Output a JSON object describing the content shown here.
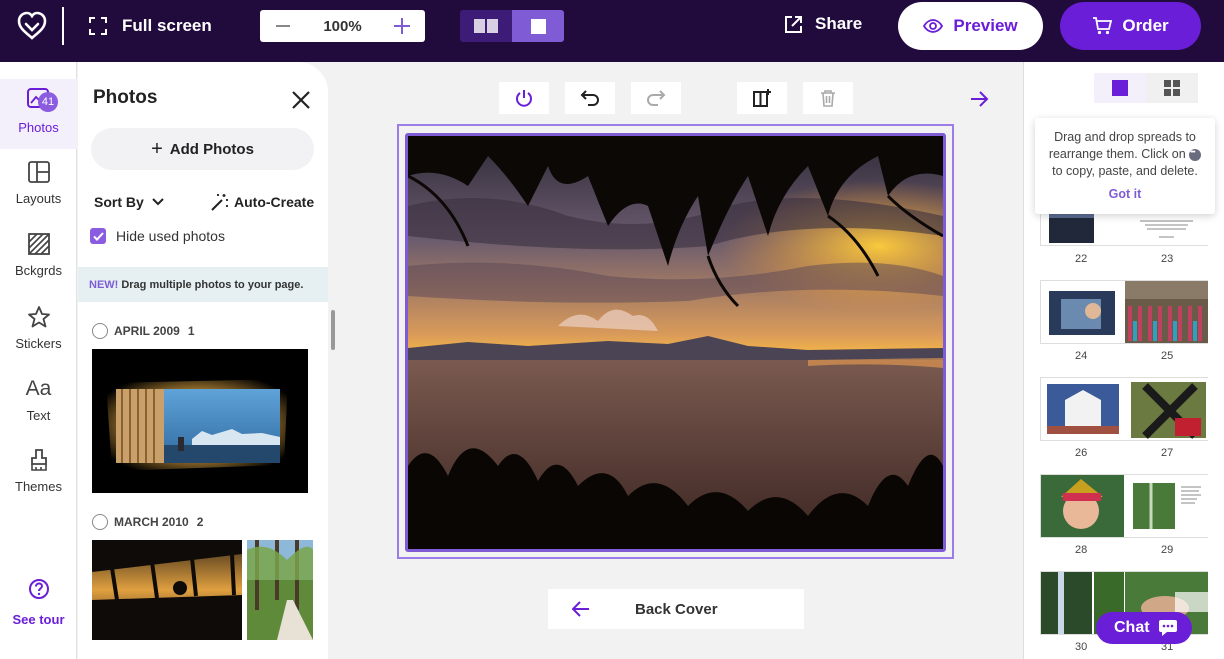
{
  "topbar": {
    "fullscreen_label": "Full screen",
    "zoom_value": "100%",
    "share_label": "Share",
    "preview_label": "Preview",
    "order_label": "Order"
  },
  "rail": {
    "photos_label": "Photos",
    "photos_badge": "41",
    "layouts_label": "Layouts",
    "backgrounds_label": "Bckgrds",
    "stickers_label": "Stickers",
    "text_label": "Text",
    "themes_label": "Themes",
    "seetour_label": "See tour"
  },
  "photos_panel": {
    "title": "Photos",
    "add_label": "Add Photos",
    "sort_label": "Sort By",
    "autocreate_label": "Auto-Create",
    "hide_used_label": "Hide used photos",
    "hide_used_checked": true,
    "notice_new": "NEW!",
    "notice_text": "Drag multiple photos to your page.",
    "groups": [
      {
        "label": "APRIL 2009",
        "count": "1"
      },
      {
        "label": "MARCH 2010",
        "count": "2"
      }
    ]
  },
  "canvas": {
    "back_cover_label": "Back Cover"
  },
  "spreads_panel": {
    "tip_line1": "Drag and drop spreads to",
    "tip_line2": "rearrange them. Click on",
    "tip_line3": "to copy, paste, and delete.",
    "got_it_label": "Got it",
    "page_numbers": [
      "22",
      "23",
      "24",
      "25",
      "26",
      "27",
      "28",
      "29",
      "30",
      "31"
    ]
  },
  "chat_label": "Chat",
  "colors": {
    "topbar_bg": "#210a3c",
    "accent": "#6a1ed8",
    "accent_light": "#8b5ce0"
  }
}
